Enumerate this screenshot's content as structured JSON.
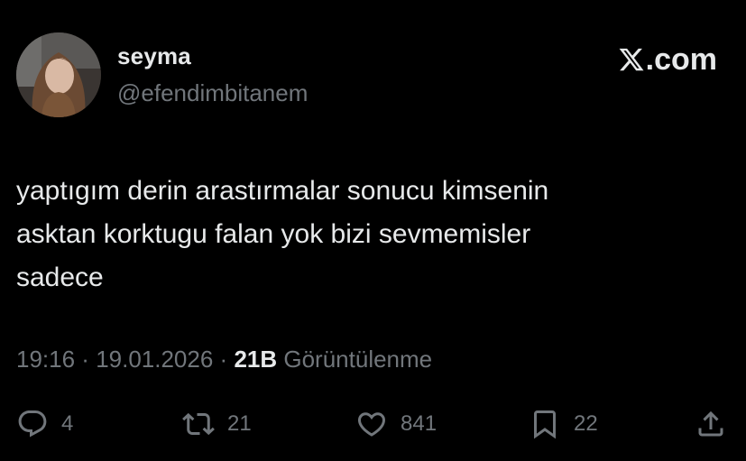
{
  "user": {
    "display_name": "seyma",
    "handle": "@efendimbitanem"
  },
  "brand": {
    "logo_icon": "x-logo-icon",
    "text": ".com"
  },
  "tweet": {
    "text": "yaptıgım derin arastırmalar sonucu kimsenin\nasktan korktugu falan yok bizi sevmemisler\nsadece"
  },
  "meta": {
    "time": "19:16",
    "separator": " · ",
    "date": "19.01.2026",
    "views_count": "21B",
    "views_label": "Görüntülenme"
  },
  "actions": {
    "reply": {
      "icon": "reply-icon",
      "count": "4"
    },
    "retweet": {
      "icon": "retweet-icon",
      "count": "21"
    },
    "like": {
      "icon": "heart-icon",
      "count": "841"
    },
    "bookmark": {
      "icon": "bookmark-icon",
      "count": "22"
    },
    "share": {
      "icon": "share-icon"
    }
  },
  "colors": {
    "background": "#000000",
    "primary_text": "#e7e9ea",
    "secondary_text": "#71767b"
  }
}
